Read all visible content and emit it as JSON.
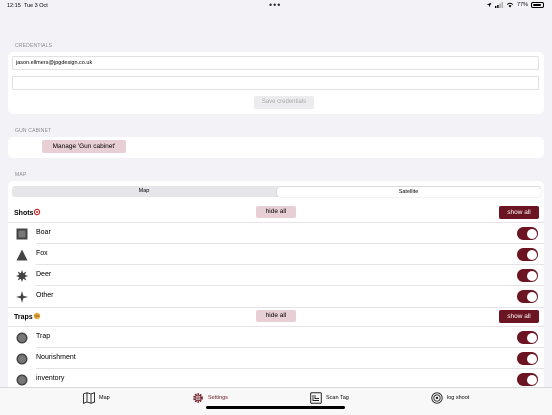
{
  "status": {
    "time": "12:15",
    "date": "Tue 3 Oct",
    "battery": "77%"
  },
  "credentials": {
    "section": "CREDENTIALS",
    "email": "jason.ellmers@jpgdesign.co.uk",
    "password": "",
    "save_label": "Save credentials"
  },
  "gun_cabinet": {
    "section": "GUN CABINET",
    "manage_label": "Manage 'Gun cabinet'"
  },
  "map": {
    "section": "MAP",
    "segments": [
      "Map",
      "Satellite"
    ],
    "selected_segment": "Satellite",
    "shots": {
      "title": "Shots",
      "hide_all": "hide all",
      "show_all": "show all",
      "items": [
        {
          "label": "Boar",
          "icon": "square-icon",
          "enabled": true
        },
        {
          "label": "Fox",
          "icon": "triangle-icon",
          "enabled": true
        },
        {
          "label": "Deer",
          "icon": "star-icon",
          "enabled": true
        },
        {
          "label": "Other",
          "icon": "four-point-star-icon",
          "enabled": true
        }
      ]
    },
    "traps": {
      "title": "Traps",
      "hide_all": "hide all",
      "show_all": "show all",
      "items": [
        {
          "label": "Trap",
          "icon": "circle-icon",
          "enabled": true
        },
        {
          "label": "Nourishment",
          "icon": "circle-icon",
          "enabled": true
        },
        {
          "label": "inventory",
          "icon": "circle-icon",
          "enabled": true
        }
      ]
    }
  },
  "tabs": [
    {
      "label": "Map",
      "icon": "map-icon"
    },
    {
      "label": "Settings",
      "icon": "gear-icon",
      "active": true
    },
    {
      "label": "Scan Tag",
      "icon": "scan-tag-icon"
    },
    {
      "label": "log shoot",
      "icon": "target-icon"
    }
  ],
  "colors": {
    "accent": "#6b1522",
    "accent_light": "#e8cfd5",
    "background": "#f2f2f7"
  }
}
